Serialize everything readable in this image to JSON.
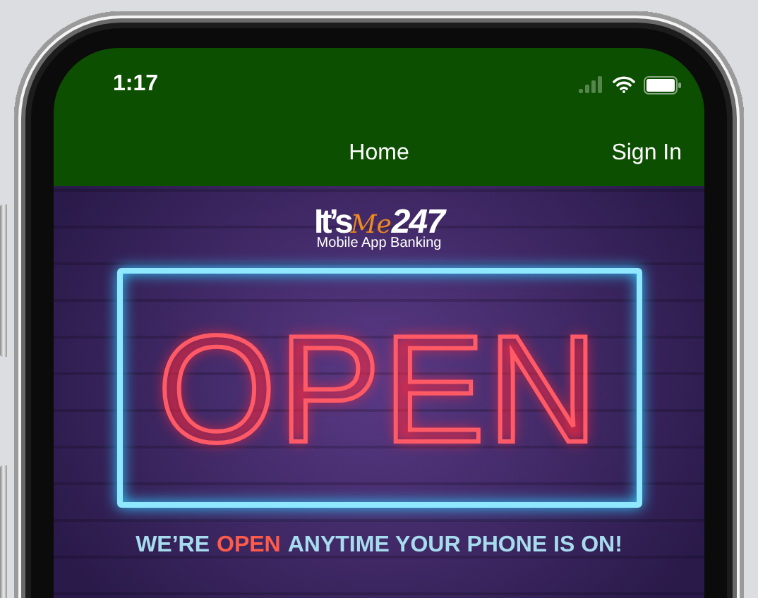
{
  "status_bar": {
    "time": "1:17"
  },
  "nav": {
    "title": "Home",
    "action": "Sign In"
  },
  "banner": {
    "logo": {
      "brand": "It’s",
      "accent": "Me",
      "number": "247",
      "subtitle": "Mobile App Banking"
    },
    "sign": "OPEN",
    "tagline": [
      {
        "text": "WE’RE",
        "highlight": false
      },
      {
        "text": "OPEN",
        "highlight": true
      },
      {
        "text": "ANYTIME YOUR PHONE IS ON!",
        "highlight": false
      }
    ]
  }
}
